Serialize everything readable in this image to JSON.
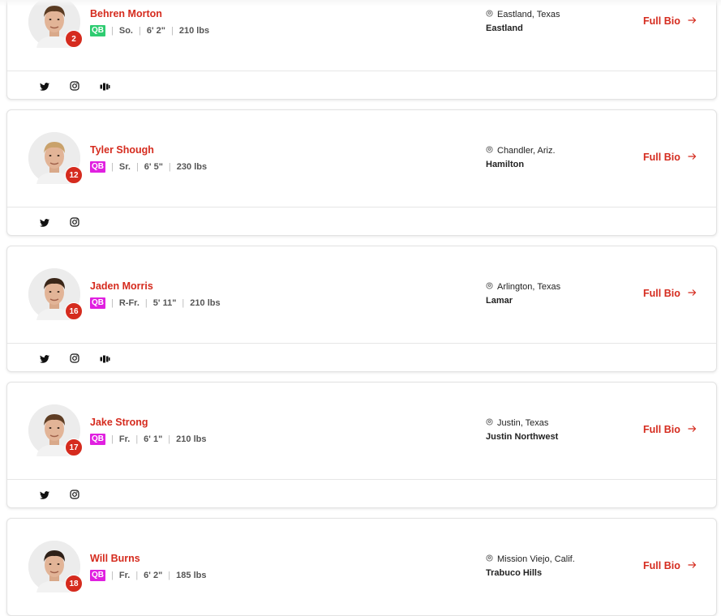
{
  "accent_color": "#d52b1e",
  "full_bio_label": "Full Bio",
  "players": [
    {
      "name": "Behren Morton",
      "number": "2",
      "position": "QB",
      "position_color": "#2ecc71",
      "class_year": "So.",
      "height": "6' 2\"",
      "weight": "210 lbs",
      "hometown": "Eastland, Texas",
      "school": "Eastland",
      "socials": [
        "twitter-icon",
        "instagram-icon",
        "hudl-icon"
      ]
    },
    {
      "name": "Tyler Shough",
      "number": "12",
      "position": "QB",
      "position_color": "#e020e0",
      "class_year": "Sr.",
      "height": "6' 5\"",
      "weight": "230 lbs",
      "hometown": "Chandler, Ariz.",
      "school": "Hamilton",
      "socials": [
        "twitter-icon",
        "instagram-icon"
      ]
    },
    {
      "name": "Jaden Morris",
      "number": "16",
      "position": "QB",
      "position_color": "#e020e0",
      "class_year": "R-Fr.",
      "height": "5' 11\"",
      "weight": "210 lbs",
      "hometown": "Arlington, Texas",
      "school": "Lamar",
      "socials": [
        "twitter-icon",
        "instagram-icon",
        "hudl-icon"
      ]
    },
    {
      "name": "Jake Strong",
      "number": "17",
      "position": "QB",
      "position_color": "#e020e0",
      "class_year": "Fr.",
      "height": "6' 1\"",
      "weight": "210 lbs",
      "hometown": "Justin, Texas",
      "school": "Justin Northwest",
      "socials": [
        "twitter-icon",
        "instagram-icon"
      ]
    },
    {
      "name": "Will Burns",
      "number": "18",
      "position": "QB",
      "position_color": "#e020e0",
      "class_year": "Fr.",
      "height": "6' 2\"",
      "weight": "185 lbs",
      "hometown": "Mission Viejo, Calif.",
      "school": "Trabuco Hills",
      "socials": []
    }
  ]
}
